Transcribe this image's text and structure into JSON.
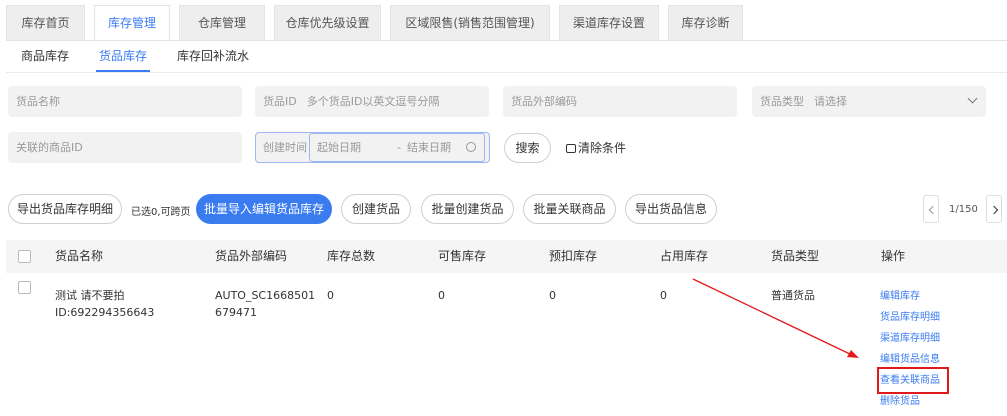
{
  "top_tabs": [
    {
      "label": "库存首页"
    },
    {
      "label": "库存管理"
    },
    {
      "label": "仓库管理"
    },
    {
      "label": "仓库优先级设置"
    },
    {
      "label": "区域限售(销售范围管理)"
    },
    {
      "label": "渠道库存设置"
    },
    {
      "label": "库存诊断"
    }
  ],
  "sub_tabs": [
    {
      "label": "商品库存"
    },
    {
      "label": "货品库存"
    },
    {
      "label": "库存回补流水"
    }
  ],
  "filters": {
    "goods_name": "货品名称",
    "goods_id_label": "货品ID",
    "goods_id_placeholder": "多个货品ID以英文逗号分隔",
    "external_code": "货品外部编码",
    "goods_type_label": "货品类型",
    "goods_type_placeholder": "请选择",
    "linked_item_id": "关联的商品ID",
    "create_time_label": "创建时间",
    "start_date": "起始日期",
    "date_separator": "-",
    "end_date": "结束日期",
    "search": "搜索",
    "clear": "清除条件"
  },
  "actions": {
    "export_detail": "导出货品库存明细",
    "selected_note": "已选0,可跨页",
    "batch_import": "批量导入编辑货品库存",
    "create": "创建货品",
    "batch_create": "批量创建货品",
    "batch_link": "批量关联商品",
    "export_info": "导出货品信息"
  },
  "pager": {
    "text": "1/150"
  },
  "table": {
    "headers": [
      "货品名称",
      "货品外部编码",
      "库存总数",
      "可售库存",
      "预扣库存",
      "占用库存",
      "货品类型",
      "操作"
    ],
    "rows": [
      {
        "name": "测试 请不要拍",
        "id": "ID:692294356643",
        "external_code_1": "AUTO_SC1668501",
        "external_code_2": "679471",
        "total": "0",
        "sellable": "0",
        "withheld": "0",
        "occupied": "0",
        "type": "普通货品",
        "ops": [
          "编辑库存",
          "货品库存明细",
          "渠道库存明细",
          "编辑货品信息",
          "查看关联商品",
          "删除货品"
        ]
      }
    ]
  },
  "colors": {
    "accent": "#3a7cf0",
    "highlight": "#e0191a"
  }
}
